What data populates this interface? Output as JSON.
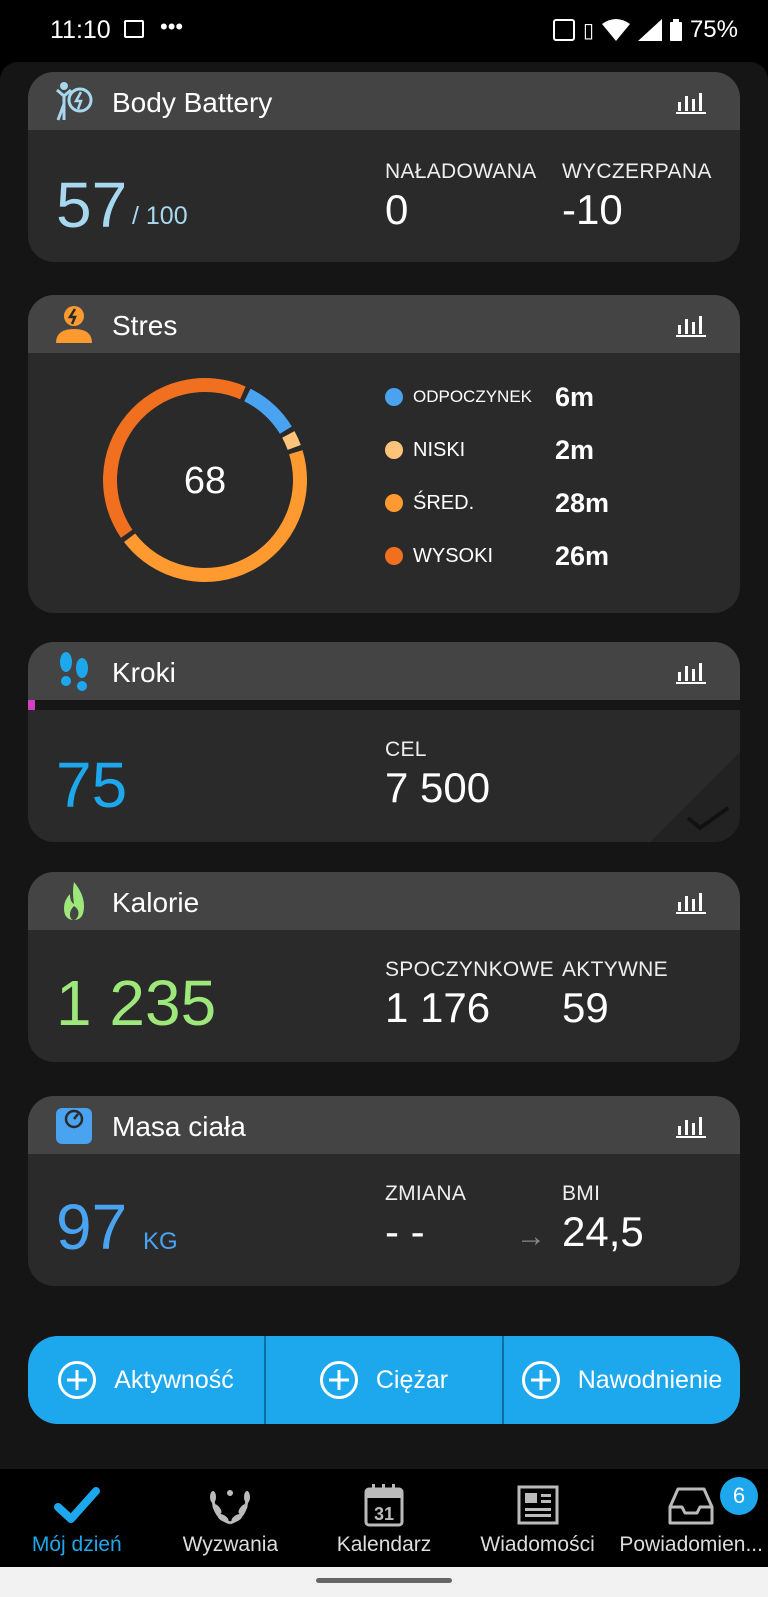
{
  "status": {
    "time": "11:10",
    "battery": "75%"
  },
  "body_battery": {
    "title": "Body Battery",
    "value": "57",
    "max": "/ 100",
    "charged_label": "NAŁADOWANA",
    "charged": "0",
    "drained_label": "WYCZERPANA",
    "drained": "-10",
    "accent": "#a8d8f0"
  },
  "stress": {
    "title": "Stres",
    "value": "68",
    "legend": [
      {
        "label": "ODPOCZYNEK",
        "value": "6m",
        "color": "#4aa3f0"
      },
      {
        "label": "NISKI",
        "value": "2m",
        "color": "#ffc37a"
      },
      {
        "label": "ŚRED.",
        "value": "28m",
        "color": "#ff9a30"
      },
      {
        "label": "WYSOKI",
        "value": "26m",
        "color": "#f07020"
      }
    ]
  },
  "steps": {
    "title": "Kroki",
    "value": "75",
    "goal_label": "CEL",
    "goal": "7 500",
    "accent": "#1da8ee",
    "progress": 0.01
  },
  "calories": {
    "title": "Kalorie",
    "value": "1 235",
    "resting_label": "SPOCZYNKOWE",
    "resting": "1 176",
    "active_label": "AKTYWNE",
    "active": "59",
    "accent": "#9ee77a"
  },
  "weight": {
    "title": "Masa ciała",
    "value": "97",
    "unit": "KG",
    "change_label": "ZMIANA",
    "change": "- -",
    "bmi_label": "BMI",
    "bmi": "24,5",
    "accent": "#4aa3f0"
  },
  "actions": [
    {
      "label": "Aktywność"
    },
    {
      "label": "Ciężar"
    },
    {
      "label": "Nawodnienie"
    }
  ],
  "nav": [
    {
      "label": "Mój dzień",
      "icon": "check-icon"
    },
    {
      "label": "Wyzwania",
      "icon": "laurel-icon"
    },
    {
      "label": "Kalendarz",
      "icon": "calendar-icon",
      "day": "31"
    },
    {
      "label": "Wiadomości",
      "icon": "news-icon"
    },
    {
      "label": "Powiadomien...",
      "icon": "inbox-icon",
      "badge": "6"
    }
  ]
}
